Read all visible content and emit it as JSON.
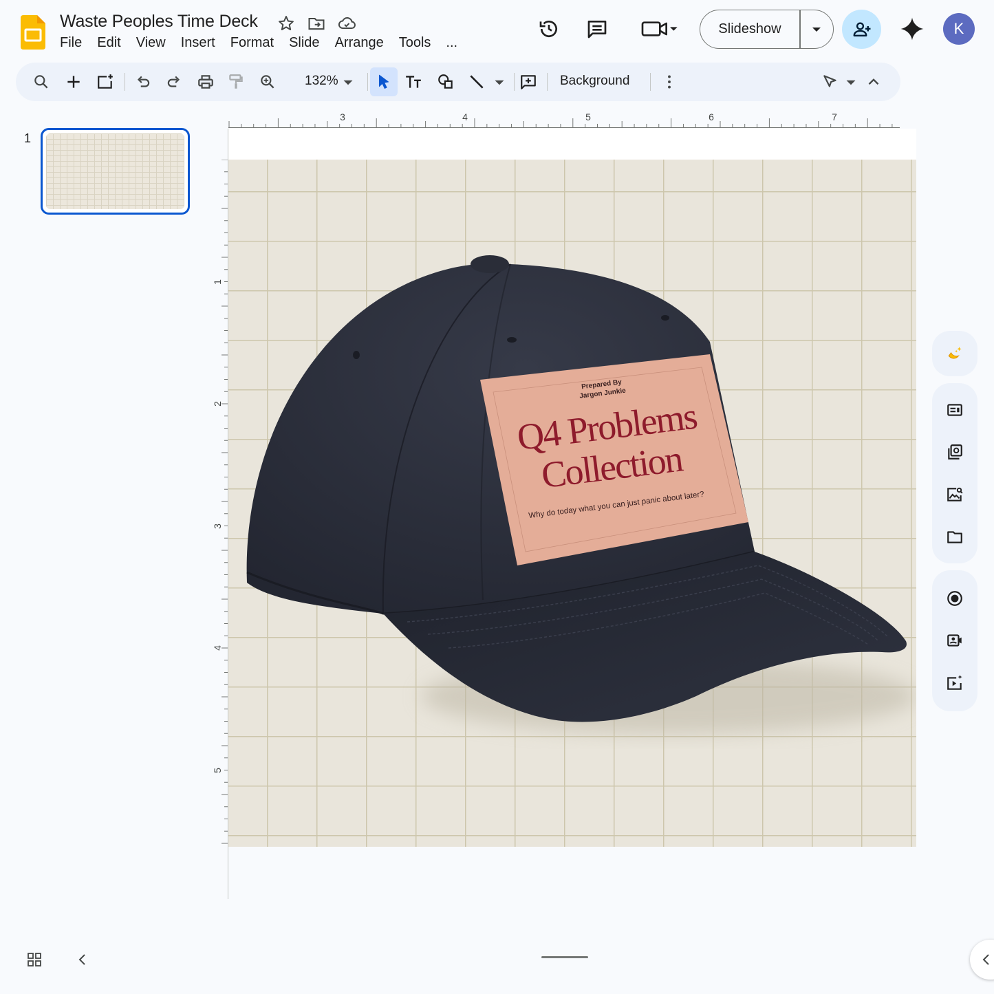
{
  "app": {
    "title": "Waste Peoples Time Deck",
    "menu": [
      "File",
      "Edit",
      "View",
      "Insert",
      "Format",
      "Slide",
      "Arrange",
      "Tools",
      "..."
    ]
  },
  "header": {
    "slideshow_label": "Slideshow",
    "avatar_initial": "K",
    "colors": {
      "share_bg": "#c2e7ff",
      "avatar_bg": "#5c6bc0"
    }
  },
  "toolbar": {
    "zoom": "132%",
    "background_label": "Background"
  },
  "filmstrip": {
    "slides": [
      {
        "number": "1",
        "selected": true
      }
    ]
  },
  "ruler": {
    "horizontal_labels": [
      "3",
      "4",
      "5",
      "6",
      "7"
    ],
    "vertical_labels": [
      "1",
      "2",
      "3",
      "4",
      "5"
    ]
  },
  "slide": {
    "label": {
      "prepared_by": "Prepared By",
      "author": "Jargon Junkie",
      "title_line1": "Q4 Problems",
      "title_line2": "Collection",
      "subtitle": "Why do today what you can just panic about later?"
    },
    "colors": {
      "background": "#e9e5db",
      "grid": "#cdc6ac",
      "hat": "#2b2e3a",
      "label": "#e4ad98",
      "title": "#8e1b2c"
    }
  },
  "side_panel": {
    "icons": [
      "banana-sparkle-icon",
      "text-box-icon",
      "copy-slide-icon",
      "image-search-icon",
      "folder-icon",
      "record-icon",
      "camera-icon",
      "video-sparkle-icon"
    ]
  }
}
